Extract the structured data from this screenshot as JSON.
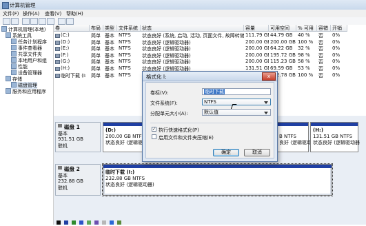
{
  "window": {
    "title": "计算机管理"
  },
  "menu": [
    "文件(F)",
    "操作(A)",
    "查看(V)",
    "帮助(H)"
  ],
  "tree": [
    {
      "label": "计算机管理(本地)",
      "depth": 0
    },
    {
      "label": "系统工具",
      "depth": 1
    },
    {
      "label": "任务计划程序",
      "depth": 2
    },
    {
      "label": "事件查看器",
      "depth": 2
    },
    {
      "label": "共享文件夹",
      "depth": 2
    },
    {
      "label": "本地用户和组",
      "depth": 2
    },
    {
      "label": "性能",
      "depth": 2
    },
    {
      "label": "设备管理器",
      "depth": 2
    },
    {
      "label": "存储",
      "depth": 1
    },
    {
      "label": "磁盘管理",
      "depth": 2
    },
    {
      "label": "服务和应用程序",
      "depth": 1
    }
  ],
  "volume_table": {
    "headers": [
      "卷",
      "布局",
      "类型",
      "文件系统",
      "状态",
      "容量",
      "可用空间",
      "% 可用",
      "容错",
      "开销"
    ],
    "rows": [
      [
        "(C:)",
        "简单",
        "基本",
        "NTFS",
        "状态良好 (系统, 启动, 活动, 页面文件, 故障转储, 主分区)",
        "111.79 GB",
        "44.79 GB",
        "40 %",
        "否",
        "0%"
      ],
      [
        "(D:)",
        "简单",
        "基本",
        "NTFS",
        "状态良好 (逻辑驱动器)",
        "200.00 GB",
        "200.00 GB",
        "100 %",
        "否",
        "0%"
      ],
      [
        "(E:)",
        "简单",
        "基本",
        "NTFS",
        "状态良好 (逻辑驱动器)",
        "200.00 GB",
        "64.22 GB",
        "32 %",
        "否",
        "0%"
      ],
      [
        "(F:)",
        "简单",
        "基本",
        "NTFS",
        "状态良好 (逻辑驱动器)",
        "200.00 GB",
        "195.72 GB",
        "98 %",
        "否",
        "0%"
      ],
      [
        "(G:)",
        "简单",
        "基本",
        "NTFS",
        "状态良好 (逻辑驱动器)",
        "200.00 GB",
        "115.23 GB",
        "58 %",
        "否",
        "0%"
      ],
      [
        "(H:)",
        "简单",
        "基本",
        "NTFS",
        "状态良好 (逻辑驱动器)",
        "131.51 GB",
        "69.59 GB",
        "53 %",
        "否",
        "0%"
      ],
      [
        "临时下载 (I:",
        "简单",
        "基本",
        "NTFS",
        "状态良好 (逻辑驱动器)",
        "232.88 GB",
        "232.78 GB",
        "100 %",
        "否",
        "0%"
      ]
    ]
  },
  "disks": [
    {
      "name": "磁盘 1",
      "type": "基本",
      "size": "931.51 GB",
      "status": "联机",
      "partitions": [
        {
          "letter": "(D:)",
          "detail": "200.00 GB NTFS",
          "status": "状态良好 (逻辑驱动器)"
        },
        {
          "letter": "",
          "detail": "B NTFS",
          "status": "良好 (逻辑驱动器)"
        },
        {
          "letter": "(H:)",
          "detail": "131.51 GB NTFS",
          "status": "状态良好 (逻辑驱动器"
        }
      ]
    },
    {
      "name": "磁盘 2",
      "type": "基本",
      "size": "232.88 GB",
      "status": "联机",
      "partitions": [
        {
          "letter": "临时下载 (I:)",
          "detail": "232.88 GB NTFS",
          "status": "状态良好 (逻辑驱动器)"
        }
      ]
    }
  ],
  "dialog": {
    "title": "格式化 I:",
    "close": "x",
    "volume_label": "卷标(V):",
    "volume_value": "临时下载",
    "fs_label": "文件系统(F):",
    "fs_value": "NTFS",
    "cluster_label": "分配单元大小(A):",
    "cluster_value": "默认值",
    "quick_format": "执行快速格式化(P)",
    "quick_checked": "✓",
    "compress": "启用文件和文件夹压缩(E)",
    "ok": "确定",
    "cancel": "取消"
  },
  "colors": {
    "partition_bar": "#1f3fa3",
    "selection": "#3d78c8",
    "legend": [
      "#101010",
      "#1f3fa3",
      "#2e8b2e",
      "#2b53c9",
      "#5aa85a",
      "#6c4fb0",
      "#b7b7b7",
      "#2b68d6",
      "#5a8a3b"
    ]
  }
}
